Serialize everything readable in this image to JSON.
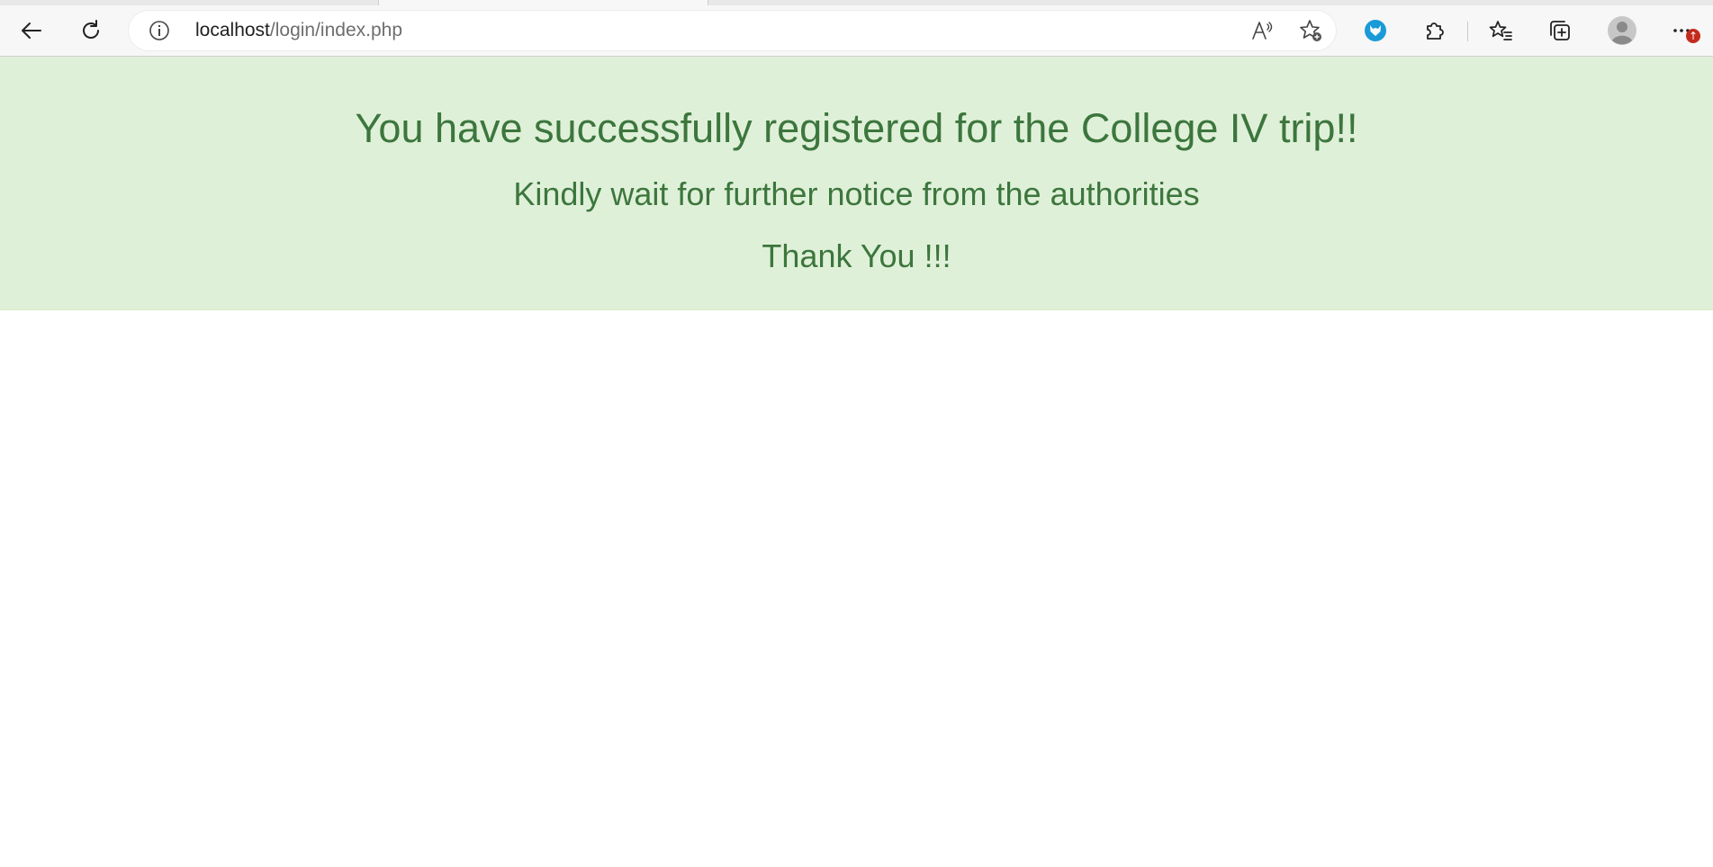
{
  "browser": {
    "address": {
      "host": "localhost",
      "path": "/login/index.php"
    },
    "icons": {
      "back": "back-arrow-icon",
      "refresh": "refresh-icon",
      "site_info": "info-icon",
      "read_aloud": "read-aloud-icon",
      "add_favorite": "add-favorite-icon",
      "extension": "fox-extension-icon",
      "extensions": "puzzle-icon",
      "favorites": "favorites-icon",
      "collections": "collections-icon",
      "profile": "profile-avatar-icon",
      "menu": "more-icon"
    },
    "menu_badge": "↑"
  },
  "page": {
    "headline": "You have successfully registered for the College IV trip!!",
    "subline": "Kindly wait for further notice from the authorities",
    "thanks": "Thank You !!!"
  },
  "colors": {
    "banner_bg": "#dff0d8",
    "banner_text": "#3c763d",
    "extension_accent": "#1a9bd7",
    "badge": "#c42b1c"
  }
}
